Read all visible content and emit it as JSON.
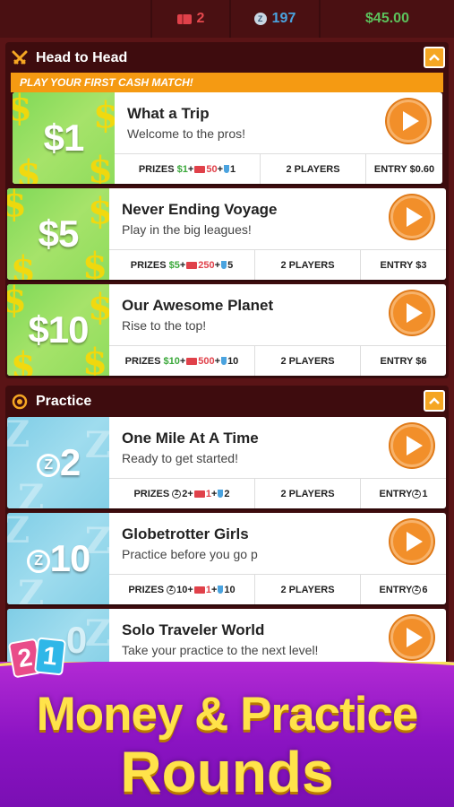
{
  "topbar": {
    "tickets": "2",
    "zcoins": "197",
    "cash": "$45.00",
    "icons": {
      "tickets": "ticket-icon",
      "zcoins": "z-coin-icon"
    }
  },
  "head_to_head": {
    "title": "Head to Head",
    "banner": "PLAY YOUR FIRST CASH MATCH!",
    "cards": [
      {
        "amount": "$1",
        "title": "What a Trip",
        "subtitle": "Welcome to the pros!",
        "prizes_label": "PRIZES",
        "prize_main": "$1",
        "prize_tickets": "50",
        "prize_trophy": "1",
        "players": "2 PLAYERS",
        "entry": "ENTRY $0.60"
      },
      {
        "amount": "$5",
        "title": "Never Ending Voyage",
        "subtitle": "Play in the big leagues!",
        "prizes_label": "PRIZES",
        "prize_main": "$5",
        "prize_tickets": "250",
        "prize_trophy": "5",
        "players": "2 PLAYERS",
        "entry": "ENTRY $3"
      },
      {
        "amount": "$10",
        "title": "Our Awesome Planet",
        "subtitle": "Rise to the top!",
        "prizes_label": "PRIZES",
        "prize_main": "$10",
        "prize_tickets": "500",
        "prize_trophy": "10",
        "players": "2 PLAYERS",
        "entry": "ENTRY $6"
      }
    ]
  },
  "practice": {
    "title": "Practice",
    "cards": [
      {
        "amount": "2",
        "title": "One Mile At A Time",
        "subtitle": "Ready to get started!",
        "prizes_label": "PRIZES",
        "prize_main": "2",
        "prize_tickets": "1",
        "prize_trophy": "2",
        "players": "2 PLAYERS",
        "entry_label": "ENTRY",
        "entry_value": "1"
      },
      {
        "amount": "10",
        "title": "Globetrotter Girls",
        "subtitle": "Practice before you go p",
        "prizes_label": "PRIZES",
        "prize_main": "10",
        "prize_tickets": "1",
        "prize_trophy": "10",
        "players": "2 PLAYERS",
        "entry_label": "ENTRY",
        "entry_value": "6"
      },
      {
        "amount": "0",
        "title": "Solo Traveler World",
        "subtitle": "Take your practice to the next level!"
      }
    ]
  },
  "promo": {
    "line1": "Money & Practice",
    "line2": "Rounds",
    "logo_digits": [
      "2",
      "1"
    ]
  }
}
